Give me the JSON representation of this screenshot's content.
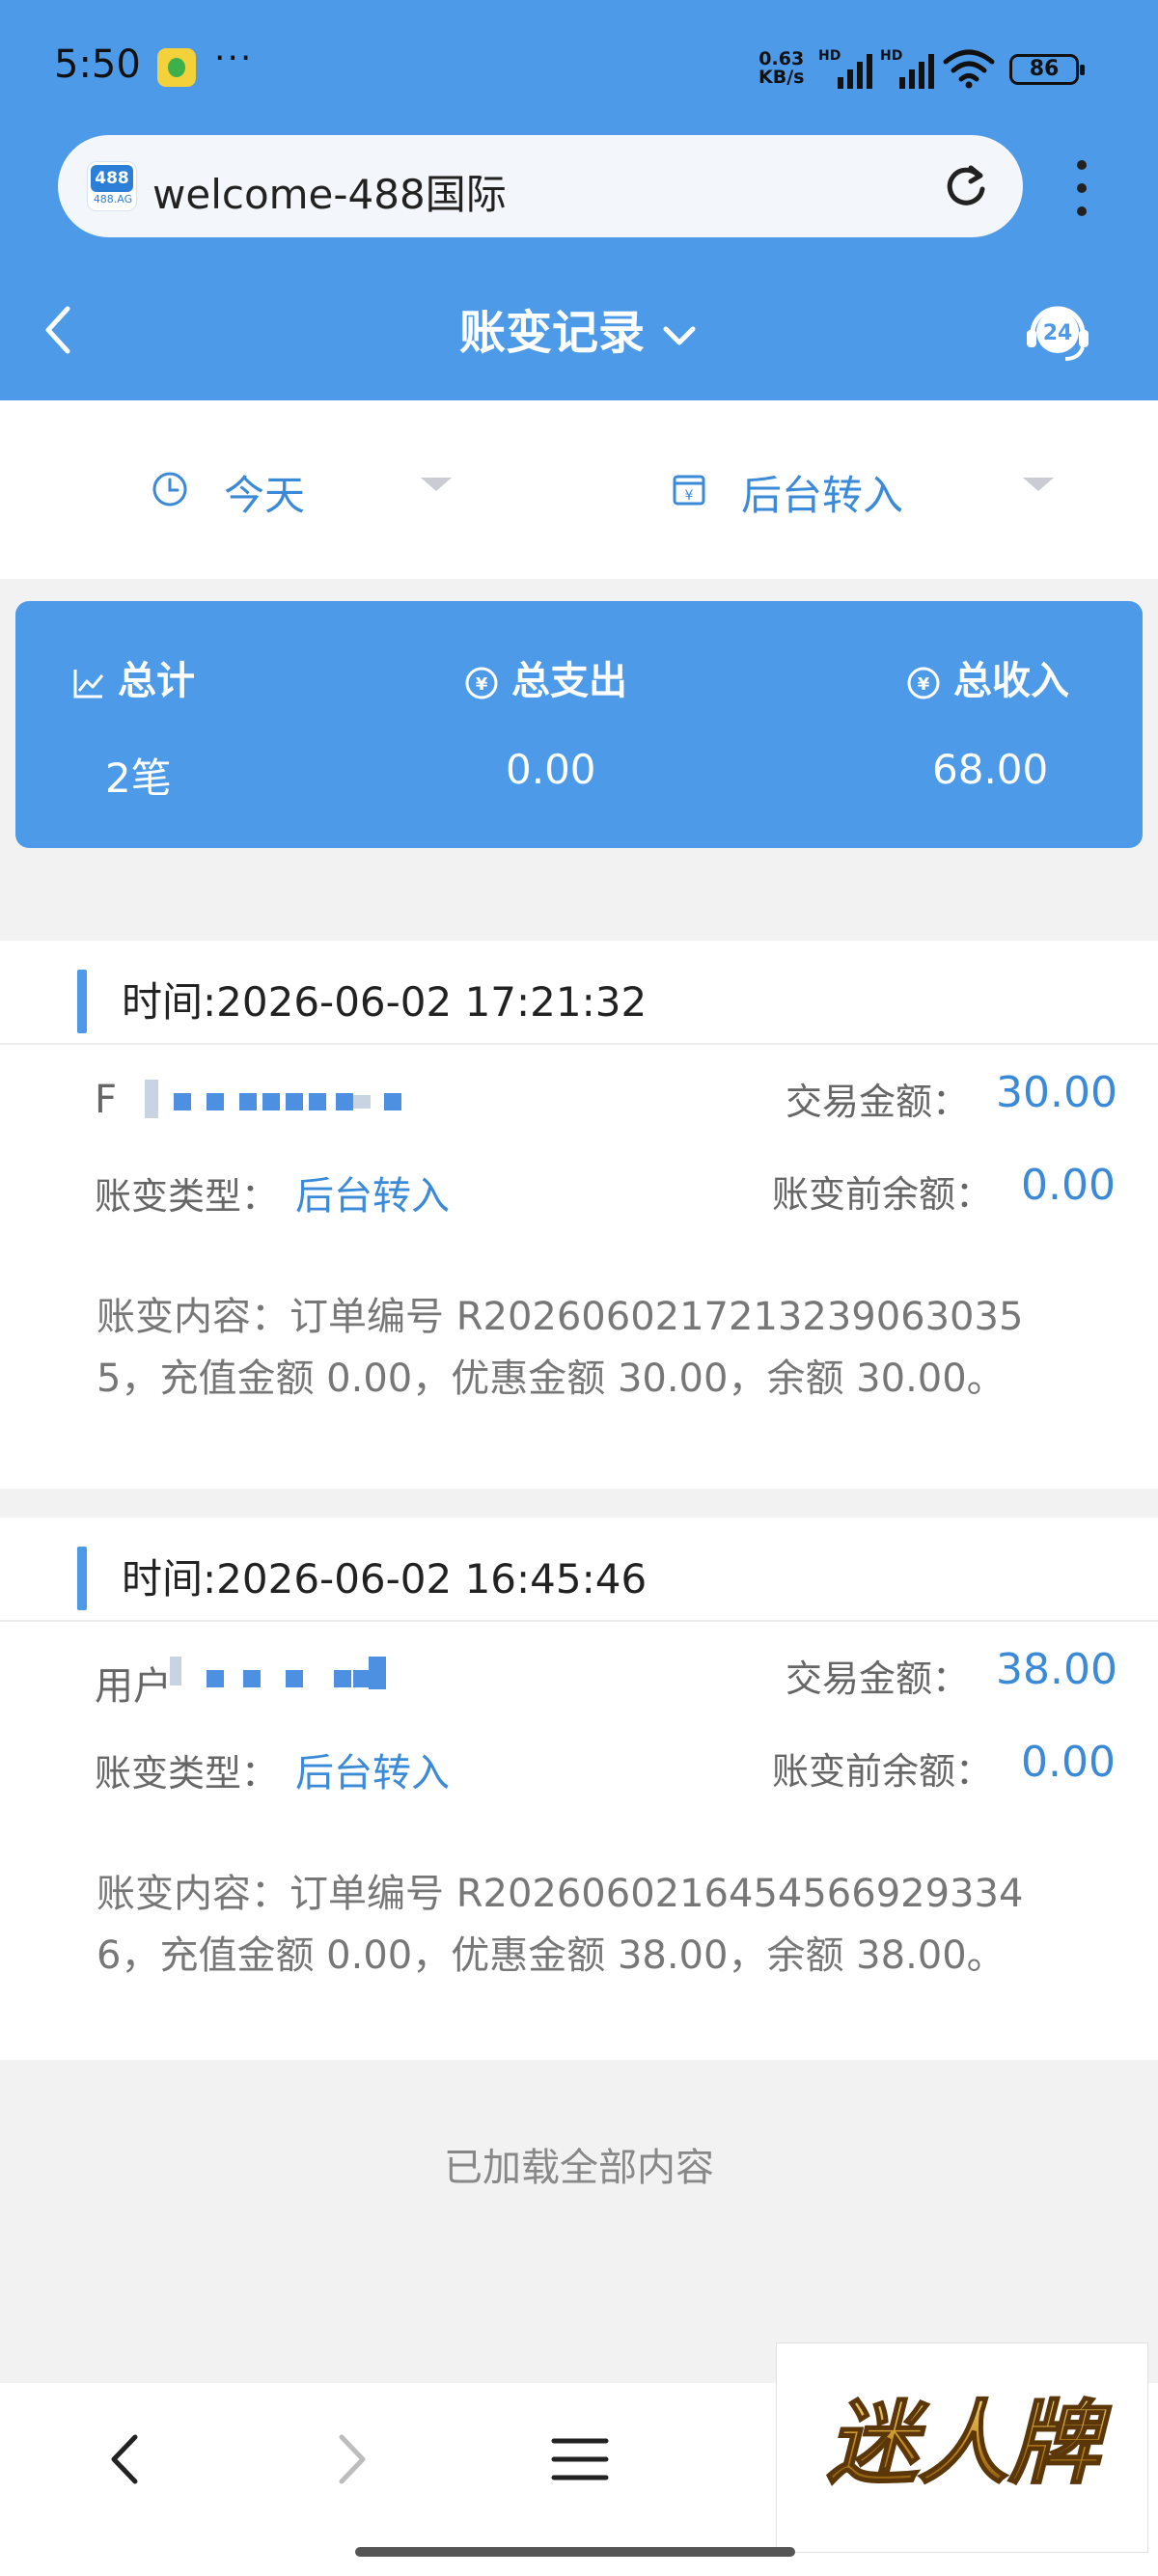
{
  "status_bar": {
    "time": "5:50",
    "dots": "···",
    "network_speed": "0.63",
    "network_unit": "KB/s",
    "hd_label": "HD",
    "battery": "86"
  },
  "browser": {
    "favicon_text": "488",
    "favicon_domain": "488.AG",
    "url": "welcome-488国际"
  },
  "header": {
    "title": "账变记录",
    "support_badge": "24"
  },
  "filters": {
    "date": "今天",
    "type": "后台转入"
  },
  "summary": {
    "total_label": "总计",
    "expense_label": "总支出",
    "income_label": "总收入",
    "total_value": "2笔",
    "expense_value": "0.00",
    "income_value": "68.00"
  },
  "records": [
    {
      "time_label": "时间:2026-06-02 17:21:32",
      "user_label": "F",
      "amount_label": "交易金额：",
      "amount": "30.00",
      "type_label": "账变类型：",
      "type": "后台转入",
      "before_label": "账变前余额：",
      "before": "0.00",
      "content": "账变内容：订单编号 R20260602172132390630355，充值金额 0.00，优惠金额 30.00，余额 30.00。"
    },
    {
      "time_label": "时间:2026-06-02 16:45:46",
      "user_label": "用户",
      "amount_label": "交易金额：",
      "amount": "38.00",
      "type_label": "账变类型：",
      "type": "后台转入",
      "before_label": "账变前余额：",
      "before": "0.00",
      "content": "账变内容：订单编号 R20260602164545669293346，充值金额 0.00，优惠金额 38.00，余额 38.00。"
    }
  ],
  "footer": {
    "loaded_text": "已加载全部内容",
    "ad_text": "迷人牌"
  },
  "colors": {
    "primary": "#4d9be8",
    "link": "#3b8ad8"
  },
  "icons": [
    "clock-icon",
    "calendar-yen-icon",
    "trend-icon",
    "yen-circle-icon",
    "support-headset-icon",
    "reload-icon",
    "back-icon",
    "forward-icon",
    "menu-icon"
  ]
}
